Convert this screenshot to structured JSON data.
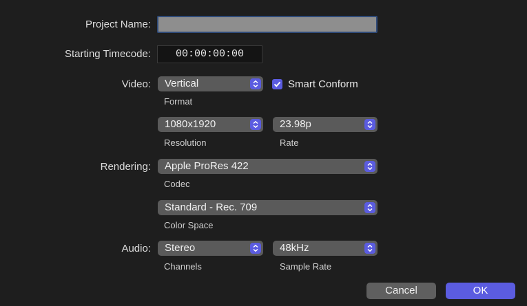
{
  "labels": {
    "project_name": "Project Name:",
    "starting_timecode": "Starting Timecode:",
    "video": "Video:",
    "rendering": "Rendering:",
    "audio": "Audio:"
  },
  "fields": {
    "project_name_value": "",
    "timecode_value": "00:00:00:00"
  },
  "video": {
    "format_value": "Vertical",
    "format_caption": "Format",
    "smart_conform_label": "Smart Conform",
    "smart_conform_checked": true,
    "resolution_value": "1080x1920",
    "resolution_caption": "Resolution",
    "rate_value": "23.98p",
    "rate_caption": "Rate"
  },
  "rendering": {
    "codec_value": "Apple ProRes 422",
    "codec_caption": "Codec",
    "color_space_value": "Standard - Rec. 709",
    "color_space_caption": "Color Space"
  },
  "audio": {
    "channels_value": "Stereo",
    "channels_caption": "Channels",
    "sample_rate_value": "48kHz",
    "sample_rate_caption": "Sample Rate"
  },
  "buttons": {
    "cancel": "Cancel",
    "ok": "OK"
  },
  "colors": {
    "accent": "#5b5ce0",
    "background": "#1e1e1e",
    "popup": "#5a5a5a"
  },
  "icons": {
    "stepper": "up-down-chevron-icon",
    "checkbox": "checkmark-icon"
  }
}
